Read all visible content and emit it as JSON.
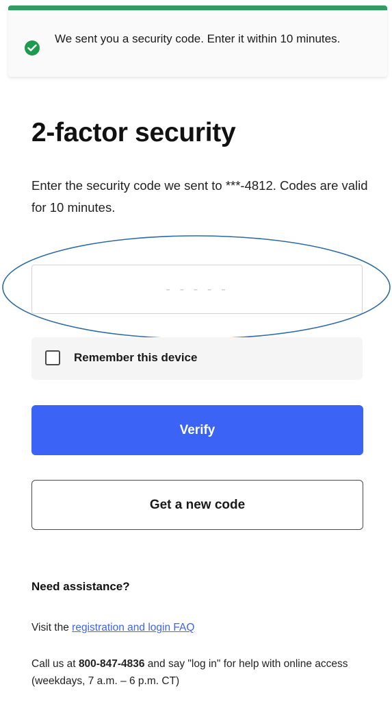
{
  "toast": {
    "message": "We sent you a security code. Enter it within 10 minutes.",
    "icon": "check-circle-icon",
    "accent_color": "#2f9e5e"
  },
  "page": {
    "title": "2-factor security",
    "instructions": "Enter the security code we sent to ***-4812. Codes are valid for 10 minutes."
  },
  "code_input": {
    "value": "",
    "placeholder": "- - - - -"
  },
  "remember": {
    "label": "Remember this device",
    "checked": false
  },
  "buttons": {
    "verify_label": "Verify",
    "new_code_label": "Get a new code",
    "verify_color": "#3b63f5"
  },
  "help": {
    "heading": "Need assistance?",
    "faq_prefix": "Visit the",
    "faq_link": "registration and login FAQ",
    "call_prefix": "Call us at",
    "phone": "800-847-4836",
    "call_suffix": "and say \"log in\" for help with online access (weekdays, 7 a.m. – 6 p.m. CT)"
  },
  "annotation": {
    "shape": "ellipse",
    "color": "#2c6aa3"
  }
}
